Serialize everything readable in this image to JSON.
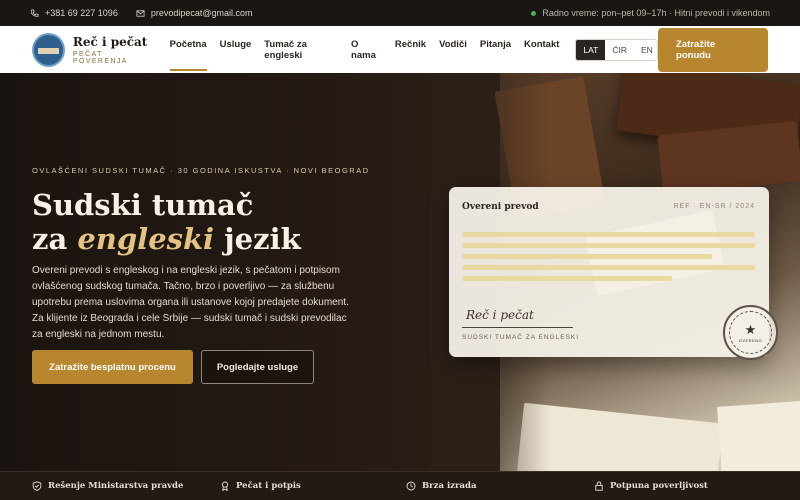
{
  "topbar": {
    "phone": "+381 69 227 1096",
    "email": "prevodipecat@gmail.com",
    "hours": "Radno vreme: pon–pet 09–17h · Hitni prevodi i vikendom",
    "icons": [
      "phone-icon",
      "mail-icon",
      "status-dot-icon"
    ]
  },
  "header": {
    "logo_title": "Reč i pečat",
    "logo_sub": "PEČAT POVERENJA",
    "nav": [
      {
        "label": "Početna",
        "active": true
      },
      {
        "label": "Usluge"
      },
      {
        "label": "Tumač za engleski"
      },
      {
        "label": "O nama"
      },
      {
        "label": "Rečnik"
      },
      {
        "label": "Vodiči"
      },
      {
        "label": "Pitanja"
      },
      {
        "label": "Kontakt"
      }
    ],
    "languages": [
      {
        "label": "LAT",
        "active": true
      },
      {
        "label": "ĆIR"
      },
      {
        "label": "EN"
      }
    ],
    "cta": "Zatražite ponudu"
  },
  "hero": {
    "kicker": "OVLAŠĆENI SUDSKI TUMAČ · 30 GODINA ISKUSTVA · NOVI BEOGRAD",
    "title_line1": "Sudski tumač",
    "title_pre": "za ",
    "title_em": "engleski",
    "title_post": " jezik",
    "lead": "Overeni prevodi s engleskog i na engleski jezik, s pečatom i potpisom ovlašćenog sudskog tumača. Tačno, brzo i poverljivo — za službenu upotrebu prema uslovima organa ili ustanove kojoj predajete dokument. Za klijente iz Beograda i cele Srbije — sudski tumač i sudski prevodilac za engleski na jednom mestu.",
    "btn_primary": "Zatražite besplatnu procenu",
    "btn_secondary": "Pogledajte usluge"
  },
  "card": {
    "title": "Overeni prevod",
    "ref": "REF · EN-SR / 2024",
    "signature": "Reč i pečat",
    "caption": "SUDSKI TUMAČ ZA ENGLESKI",
    "stamp_text": "OVERENO"
  },
  "trust": [
    {
      "label": "Rešenje Ministarstva pravde",
      "icon": "shield-icon"
    },
    {
      "label": "Pečat i potpis",
      "icon": "seal-icon"
    },
    {
      "label": "Brza izrada",
      "icon": "clock-icon"
    },
    {
      "label": "Potpuna poverljivost",
      "icon": "lock-icon"
    }
  ],
  "colors": {
    "accent": "#b8862e",
    "dark": "#1a1613",
    "highlight": "#e3c282"
  }
}
